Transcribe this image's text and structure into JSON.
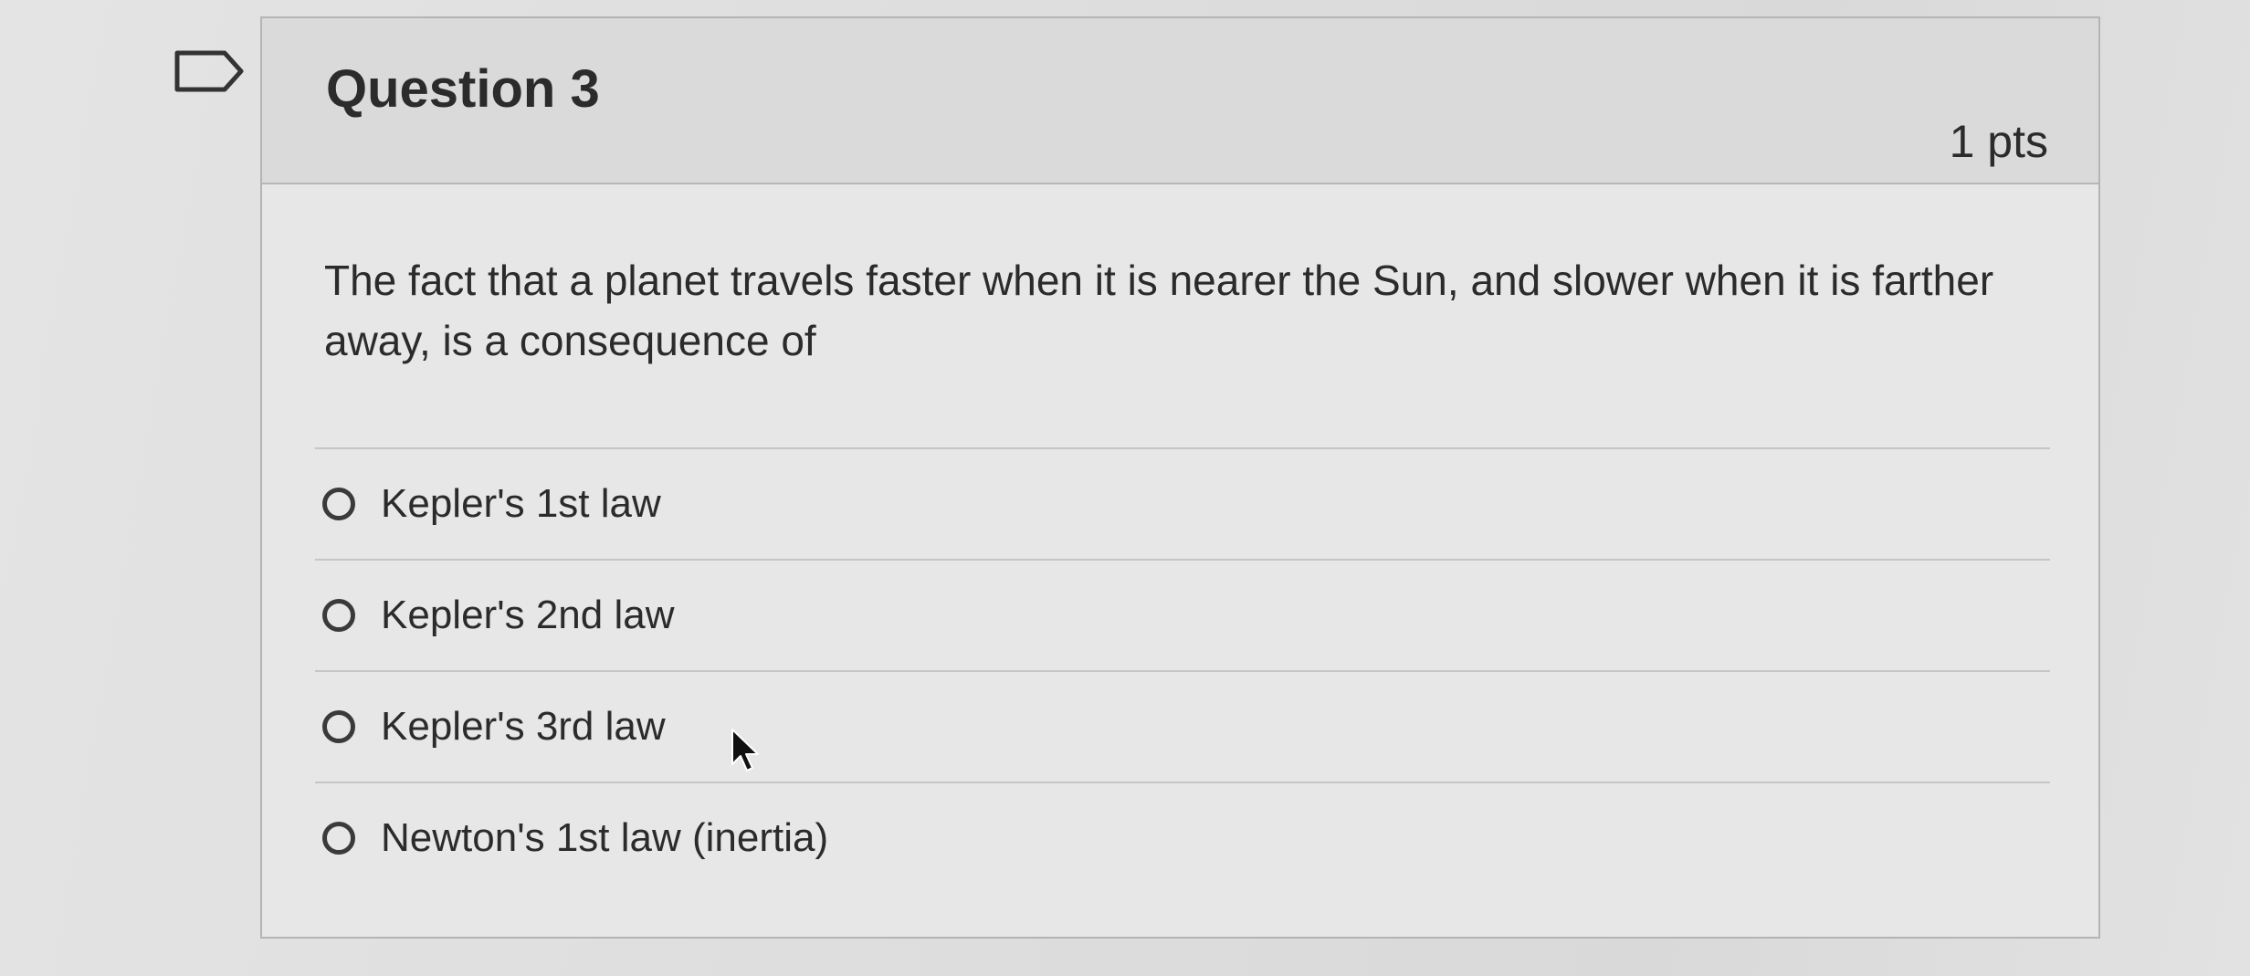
{
  "question": {
    "title": "Question 3",
    "points": "1 pts",
    "text": "The fact that a planet travels faster when it is nearer the Sun, and slower when it is farther away, is a consequence of"
  },
  "answers": [
    {
      "label": "Kepler's 1st law"
    },
    {
      "label": "Kepler's 2nd law"
    },
    {
      "label": "Kepler's 3rd law"
    },
    {
      "label": "Newton's 1st law (inertia)"
    }
  ],
  "icons": {
    "flag": "flag-question-icon",
    "cursor": "mouse-pointer-icon",
    "radio": "radio-unselected-icon"
  }
}
